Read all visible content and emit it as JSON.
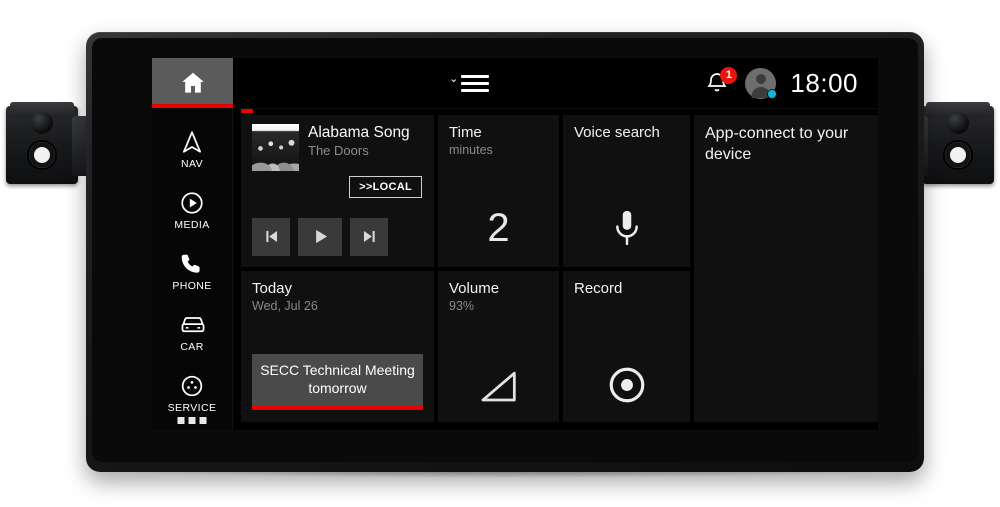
{
  "topbar": {
    "home_label": "Home",
    "menu_label": "Menu",
    "notification_count": "1",
    "time": "18:00"
  },
  "sidebar": {
    "items": [
      {
        "label": "NAV",
        "icon": "navigation-arrow-icon"
      },
      {
        "label": "MEDIA",
        "icon": "media-play-circle-icon"
      },
      {
        "label": "PHONE",
        "icon": "phone-handset-icon"
      },
      {
        "label": "CAR",
        "icon": "car-front-icon"
      },
      {
        "label": "SERVICE",
        "icon": "service-circle-icon"
      }
    ],
    "more_label": "More"
  },
  "tiles": {
    "music": {
      "track_title": "Alabama Song",
      "artist": "The Doors",
      "source_button": ">>LOCAL",
      "prev_label": "Previous track",
      "play_label": "Play",
      "next_label": "Next track",
      "album_art_alt": "Album artwork"
    },
    "time": {
      "title": "Time",
      "subtitle": "minutes",
      "value": "2"
    },
    "voice": {
      "title": "Voice search",
      "icon": "microphone-icon"
    },
    "app_connect": {
      "title": "App-connect to your device"
    },
    "calendar": {
      "title": "Today",
      "subtitle": "Wed, Jul 26",
      "event": "SECC Technical Meeting tomorrow"
    },
    "volume": {
      "title": "Volume",
      "subtitle": "93%",
      "icon": "volume-triangle-icon"
    },
    "record": {
      "title": "Record",
      "icon": "record-circle-icon"
    }
  },
  "colors": {
    "accent_red": "#e60000",
    "badge_red": "#e8140f",
    "status_cyan": "#16b4d8",
    "tile_bg": "#101010",
    "active_gray": "#5b5b5b"
  }
}
